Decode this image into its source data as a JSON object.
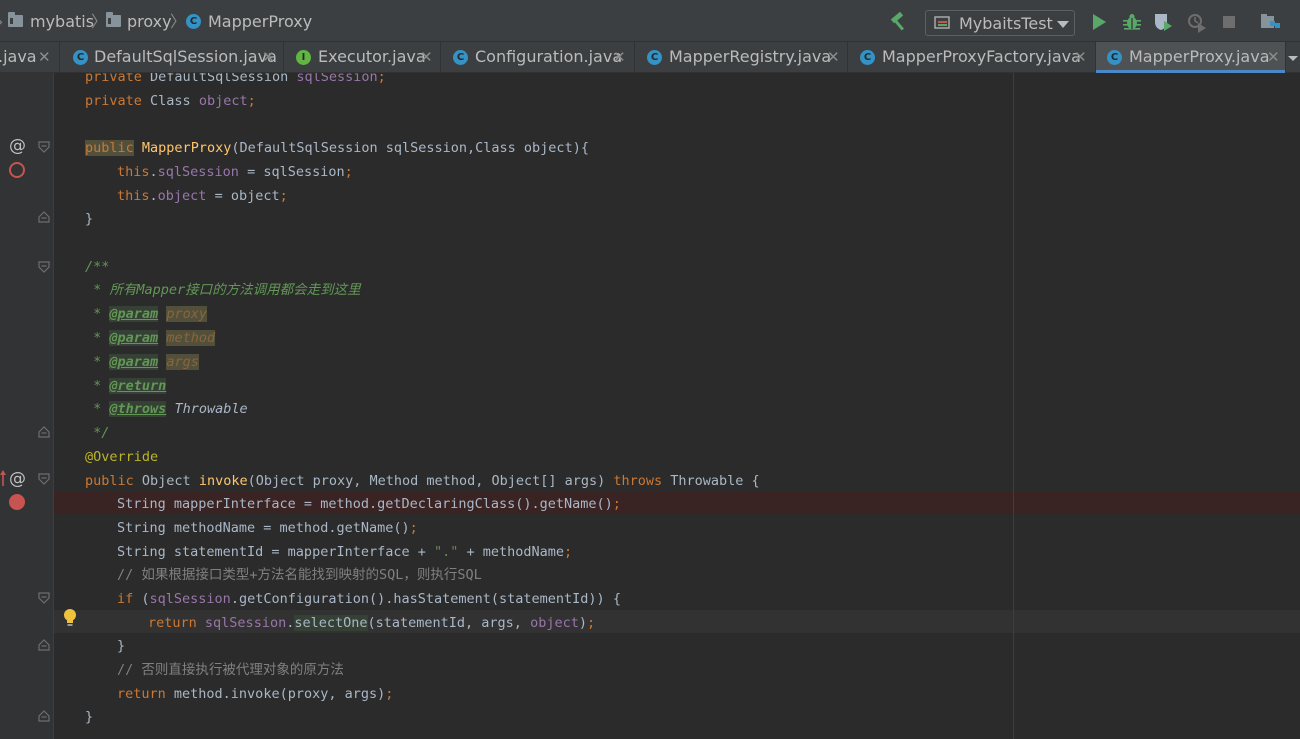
{
  "breadcrumb": {
    "items": [
      "mybatis",
      "proxy",
      "MapperProxy"
    ]
  },
  "toolbar": {
    "run_config": "MybaitsTest"
  },
  "tabs": [
    {
      "label": ".java",
      "icon": "class-icon"
    },
    {
      "label": "DefaultSqlSession.java",
      "icon": "class-icon"
    },
    {
      "label": "Executor.java",
      "icon": "interface-icon"
    },
    {
      "label": "Configuration.java",
      "icon": "class-icon"
    },
    {
      "label": "MapperRegistry.java",
      "icon": "class-icon"
    },
    {
      "label": "MapperProxyFactory.java",
      "icon": "class-icon"
    },
    {
      "label": "MapperProxy.java",
      "icon": "class-icon",
      "active": true
    }
  ],
  "code": {
    "l1": {
      "kw": "private",
      "type": "DefaultSqlSession",
      "field": "sqlSession",
      "end": ";"
    },
    "l2": {
      "kw": "private",
      "type": "Class",
      "field": "object",
      "end": ";"
    },
    "l4": {
      "kw": "public",
      "name": "MapperProxy",
      "params": "(DefaultSqlSession sqlSession,Class object){"
    },
    "l5": {
      "this": "this",
      "dot": ".",
      "field": "sqlSession",
      "rest": " = sqlSession",
      "end": ";"
    },
    "l6": {
      "this": "this",
      "dot": ".",
      "field": "object",
      "rest": " = object",
      "end": ";"
    },
    "l7": "}",
    "l9": "/**",
    "l10": {
      "prefix": " * 所有",
      "word": "Mapper",
      "suffix": "接口的方法调用都会走到这里"
    },
    "l11": {
      "star": " * ",
      "tag": "@param",
      "val": "proxy"
    },
    "l12": {
      "star": " * ",
      "tag": "@param",
      "val": "method"
    },
    "l13": {
      "star": " * ",
      "tag": "@param",
      "val": "args"
    },
    "l14": {
      "star": " * ",
      "tag": "@return"
    },
    "l15": {
      "star": " * ",
      "tag": "@throws",
      "val": "Throwable"
    },
    "l16": " */",
    "l17": "@Override",
    "l18": {
      "kw": "public",
      "ret": "Object",
      "name": "invoke",
      "params": "(Object proxy, Method method, Object[] args) ",
      "throws": "throws",
      "rest": " Throwable {"
    },
    "l19": {
      "text": "String mapperInterface = method.getDeclaringClass().getName()",
      "end": ";"
    },
    "l20": {
      "text": "String methodName = method.getName()",
      "end": ";"
    },
    "l21": {
      "pre": "String statementId = mapperInterface + ",
      "str": "\".\"",
      "post": " + methodName",
      "end": ";"
    },
    "l22": "// 如果根据接口类型+方法名能找到映射的SQL，则执行SQL",
    "l23": {
      "kw": "if",
      "open": " (",
      "field": "sqlSession",
      "rest": ".getConfiguration().hasStatement(statementId)) {"
    },
    "l24": {
      "kw": "return",
      "field": "sqlSession",
      "dot": ".",
      "method": "selectOne",
      "args": "(statementId, args, ",
      "field2": "object",
      "close": ")",
      "end": ";"
    },
    "l25": "}",
    "l26": "// 否则直接执行被代理对象的原方法",
    "l27": {
      "kw": "return",
      "rest": " method.invoke(proxy, args)",
      "end": ";"
    },
    "l28": "}"
  },
  "colors": {
    "keyword": "#cc7832",
    "field": "#9876aa",
    "method_decl": "#ffc66d",
    "annotation": "#bbb529",
    "comment": "#808080",
    "doc_comment": "#629755",
    "breakpoint": "#c75450",
    "tab_accent": "#4a88c7"
  }
}
